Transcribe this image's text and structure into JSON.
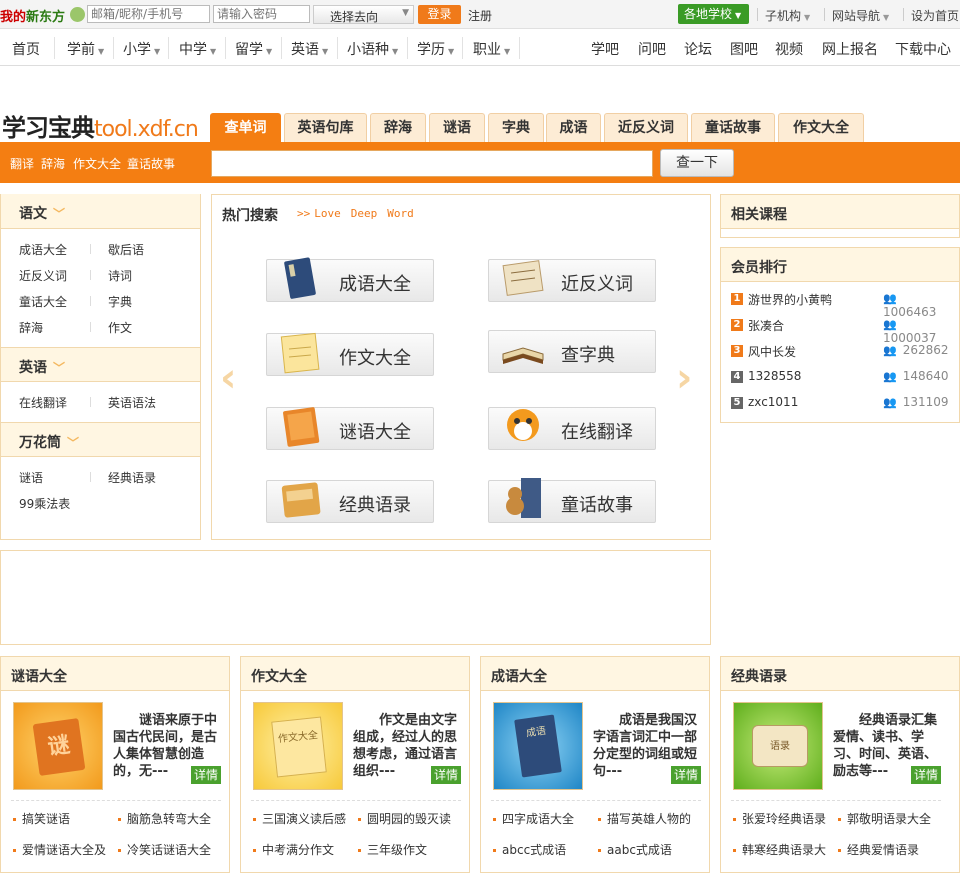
{
  "topbar": {
    "brand_prefix": "我的",
    "brand_name": "新东方",
    "login_placeholder": "邮箱/昵称/手机号",
    "password_placeholder": "请输入密码",
    "destination_select": "选择去向",
    "login_button": "登录",
    "register_link": "注册",
    "schools_button": "各地学校",
    "links": [
      "子机构",
      "网站导航",
      "设为首页"
    ]
  },
  "mainnav": {
    "left": [
      {
        "label": "首页",
        "dropdown": false
      },
      {
        "label": "学前",
        "dropdown": true
      },
      {
        "label": "小学",
        "dropdown": true
      },
      {
        "label": "中学",
        "dropdown": true
      },
      {
        "label": "留学",
        "dropdown": true
      },
      {
        "label": "英语",
        "dropdown": true
      },
      {
        "label": "小语种",
        "dropdown": true
      },
      {
        "label": "学历",
        "dropdown": true
      },
      {
        "label": "职业",
        "dropdown": true
      }
    ],
    "right": [
      "学吧",
      "问吧",
      "论坛",
      "图吧",
      "视频",
      "网上报名",
      "下载中心"
    ]
  },
  "logo": {
    "text": "学习宝典",
    "domain": "tool.xdf.cn"
  },
  "tabs": [
    "查单词",
    "英语句库",
    "辞海",
    "谜语",
    "字典",
    "成语",
    "近反义词",
    "童话故事",
    "作文大全"
  ],
  "quick_links": [
    "翻译",
    "辞海",
    "作文大全",
    "童话故事"
  ],
  "search": {
    "value": "",
    "button": "查一下"
  },
  "sidebar": {
    "sections": [
      {
        "title": "语文",
        "links": [
          "成语大全",
          "歇后语",
          "近反义词",
          "诗词",
          "童话大全",
          "字典",
          "辞海",
          "作文"
        ]
      },
      {
        "title": "英语",
        "links": [
          "在线翻译",
          "英语语法"
        ]
      },
      {
        "title": "万花筒",
        "links": [
          "谜语",
          "经典语录",
          "99乘法表"
        ]
      }
    ]
  },
  "hot": {
    "title": "热门搜索",
    "marker": ">>",
    "words": [
      "Love",
      "Deep",
      "Word"
    ],
    "items": [
      "成语大全",
      "近反义词",
      "作文大全",
      "查字典",
      "谜语大全",
      "在线翻译",
      "经典语录",
      "童话故事"
    ]
  },
  "related_courses": {
    "title": "相关课程"
  },
  "ranking": {
    "title": "会员排行",
    "rows": [
      {
        "rank": "1",
        "name": "游世界的小黄鸭",
        "score": "1006463"
      },
      {
        "rank": "2",
        "name": "张凑合",
        "score": "1000037"
      },
      {
        "rank": "3",
        "name": "风中长发",
        "score": "262862"
      },
      {
        "rank": "4",
        "name": "1328558",
        "score": "148640"
      },
      {
        "rank": "5",
        "name": "zxc1011",
        "score": "131109"
      }
    ]
  },
  "cards": [
    {
      "title": "谜语大全",
      "thumb": "谜",
      "desc": "谜语来原于中国古代民间，是古人集体智慧创造的，无---",
      "detail": "详情",
      "links": [
        "搞笑谜语",
        "脑筋急转弯大全",
        "爱情谜语大全及",
        "冷笑话谜语大全"
      ],
      "color": "#f4a623"
    },
    {
      "title": "作文大全",
      "thumb": "作文大全",
      "desc": "作文是由文字组成，经过人的思想考虑，通过语言组织---",
      "detail": "详情",
      "links": [
        "三国演义读后感",
        "圆明园的毁灭读",
        "中考满分作文",
        "三年级作文"
      ],
      "color": "#f8d24a"
    },
    {
      "title": "成语大全",
      "thumb": "成语",
      "desc": "成语是我国汉字语言词汇中一部分定型的词组或短句---",
      "detail": "详情",
      "links": [
        "四字成语大全",
        "描写英雄人物的",
        "abcc式成语",
        "aabc式成语"
      ],
      "color": "#3aa0d8"
    },
    {
      "title": "经典语录",
      "thumb": "语录",
      "desc": "经典语录汇集爱情、读书、学习、时间、英语、励志等---",
      "detail": "详情",
      "links": [
        "张爱玲经典语录",
        "郭敬明语录大全",
        "韩寒经典语录大",
        "经典爱情语录"
      ],
      "color": "#8cc63f"
    }
  ]
}
